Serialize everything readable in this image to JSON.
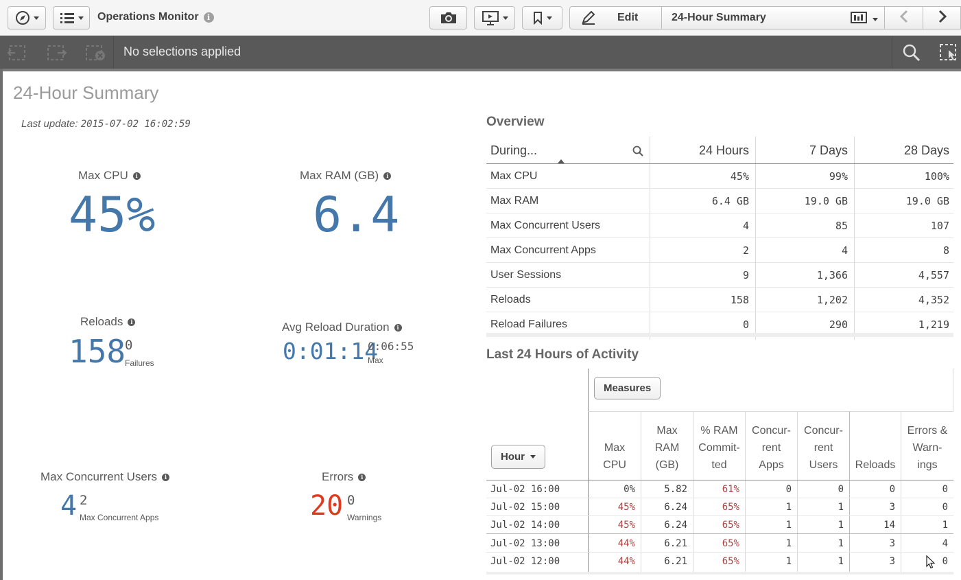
{
  "toolbar": {
    "app_title": "Operations Monitor",
    "edit_label": "Edit",
    "sheet_name": "24-Hour Summary"
  },
  "selection_bar": {
    "status_text": "No selections applied"
  },
  "sheet": {
    "title": "24-Hour Summary",
    "last_update_label": "Last update:",
    "last_update_value": "2015-07-02 16:02:59"
  },
  "kpis": {
    "max_cpu": {
      "label": "Max CPU",
      "value": "45%"
    },
    "max_ram": {
      "label": "Max RAM (GB)",
      "value": "6.4"
    },
    "reloads": {
      "label": "Reloads",
      "value": "158",
      "sub_value": "0",
      "sub_caption": "Failures"
    },
    "avg_reload": {
      "label": "Avg Reload Duration",
      "value": "0:01:14",
      "sub_value": "0:06:55",
      "sub_caption": "Max"
    },
    "max_users": {
      "label": "Max Concurrent Users",
      "value": "4",
      "sub_value": "2",
      "sub_caption": "Max Concurrent Apps"
    },
    "errors": {
      "label": "Errors",
      "value": "20",
      "sub_value": "0",
      "sub_caption": "Warnings"
    }
  },
  "overview": {
    "title": "Overview",
    "headers": [
      "During...",
      "24 Hours",
      "7 Days",
      "28 Days"
    ],
    "rows": [
      [
        "Max CPU",
        "45%",
        "99%",
        "100%"
      ],
      [
        "Max RAM",
        "6.4 GB",
        "19.0 GB",
        "19.0 GB"
      ],
      [
        "Max Concurrent Users",
        "4",
        "85",
        "107"
      ],
      [
        "Max Concurrent Apps",
        "2",
        "4",
        "8"
      ],
      [
        "User Sessions",
        "9",
        "1,366",
        "4,557"
      ],
      [
        "Reloads",
        "158",
        "1,202",
        "4,352"
      ],
      [
        "Reload Failures",
        "0",
        "290",
        "1,219"
      ]
    ]
  },
  "activity": {
    "title": "Last 24 Hours of Activity",
    "measures_label": "Measures",
    "hour_label": "Hour",
    "headers": [
      "Max CPU",
      "Max RAM (GB)",
      "% RAM Commit-ted",
      "Concur-rent Apps",
      "Concur-rent Users",
      "Reloads",
      "Errors & Warn-ings"
    ],
    "rows": [
      [
        "Jul-02 16:00",
        "0%",
        "5.82",
        "61%",
        "0",
        "0",
        "0",
        "0"
      ],
      [
        "Jul-02 15:00",
        "45%",
        "6.24",
        "65%",
        "1",
        "1",
        "3",
        "0"
      ],
      [
        "Jul-02 14:00",
        "45%",
        "6.24",
        "65%",
        "1",
        "1",
        "14",
        "1"
      ],
      [
        "Jul-02 13:00",
        "44%",
        "6.21",
        "65%",
        "1",
        "1",
        "3",
        "4"
      ],
      [
        "Jul-02 12:00",
        "44%",
        "6.21",
        "65%",
        "1",
        "1",
        "3",
        "0"
      ]
    ]
  },
  "colors": {
    "kpi_blue": "#4477aa",
    "error_red": "#e03a1e",
    "pct_red": "#a94442",
    "selection_bar": "#595959"
  }
}
